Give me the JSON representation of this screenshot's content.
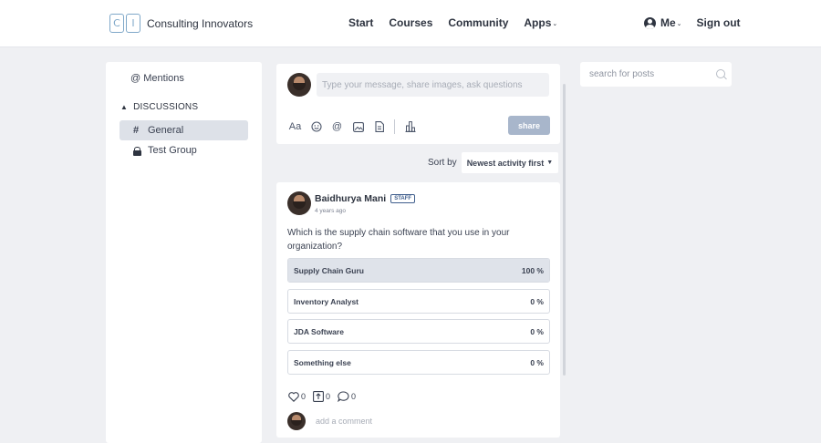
{
  "brand": {
    "mark_left": "C",
    "mark_right": "I",
    "name": "Consulting Innovators"
  },
  "nav": {
    "items": [
      "Start",
      "Courses",
      "Community"
    ],
    "apps_label": "Apps"
  },
  "user": {
    "me_label": "Me",
    "signout_label": "Sign out"
  },
  "sidebar": {
    "mentions_label": "Mentions",
    "section_label": "DISCUSSIONS",
    "items": [
      {
        "label": "General",
        "icon": "hash-icon"
      },
      {
        "label": "Test Group",
        "icon": "lock-icon"
      }
    ]
  },
  "composer": {
    "placeholder": "Type your message, share images, ask questions",
    "tools": [
      "text-format-icon",
      "emoji-icon",
      "mention-icon",
      "image-icon",
      "file-icon",
      "poll-icon"
    ],
    "format_label": "Aa",
    "share_label": "share"
  },
  "sort": {
    "label": "Sort by",
    "value": "Newest activity first"
  },
  "post": {
    "author": "Baidhurya Mani",
    "badge": "STAFF",
    "time": "4 years ago",
    "question": "Which is the supply chain software that you use in your organization?",
    "options": [
      {
        "label": "Supply Chain Guru",
        "percent_label": "100 %",
        "share": 1.0
      },
      {
        "label": "Inventory Analyst",
        "percent_label": "0 %",
        "share": 0
      },
      {
        "label": "JDA Software",
        "percent_label": "0 %",
        "share": 0
      },
      {
        "label": "Something else",
        "percent_label": "0 %",
        "share": 0
      }
    ],
    "likes": "0",
    "upvotes": "0",
    "comments": "0",
    "comment_placeholder": "add a comment"
  },
  "search": {
    "placeholder": "search for posts"
  },
  "colors": {
    "accent": "#3f5e8c",
    "share_button": "#a8b6cb",
    "poll_fill": "#dfe3ea"
  }
}
